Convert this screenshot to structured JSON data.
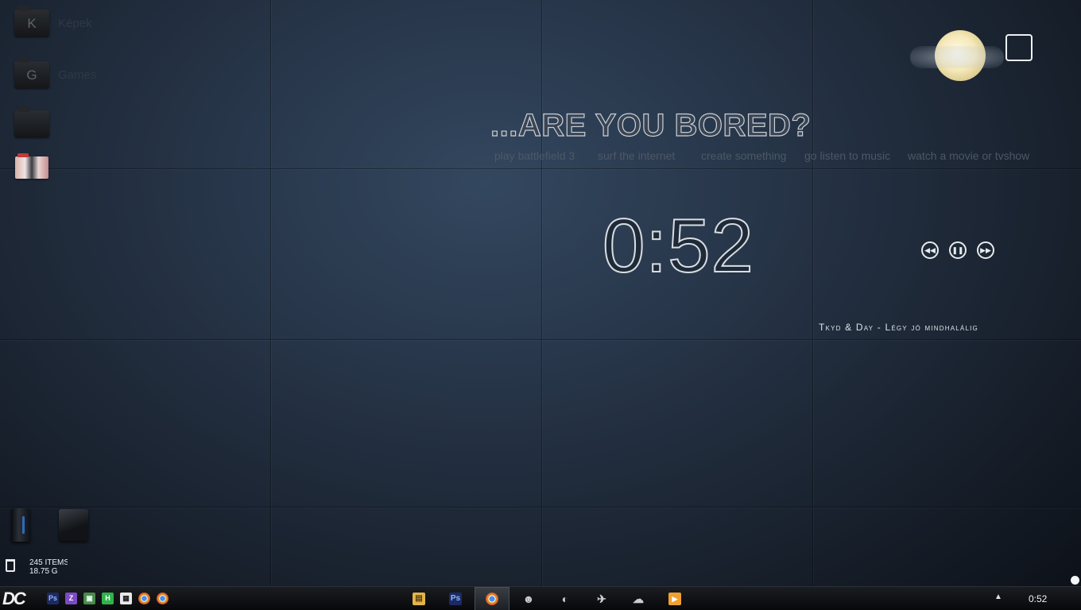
{
  "desktop": {
    "folders": [
      {
        "letter": "K",
        "label": "Képek"
      },
      {
        "letter": "G",
        "label": "Games"
      },
      {
        "letter": "",
        "label": ""
      }
    ]
  },
  "prompt": {
    "headline": "...ARE YOU BORED?",
    "activities": [
      "play battlefield 3",
      "surf the internet",
      "create something",
      "go listen to music",
      "watch a movie or tvshow"
    ]
  },
  "clock": {
    "time": "0:52"
  },
  "media": {
    "track": "Tkyd & Day - Légy jó mindhalálig",
    "prev_glyph": "◀◀",
    "pause_glyph": "❚❚",
    "next_glyph": "▶▶"
  },
  "recycle_bin": {
    "items": "245 ITEMS",
    "size": "18.75 G"
  },
  "taskbar": {
    "start_label": "DC",
    "quick_launch": [
      {
        "icon": "photoshop-icon",
        "glyph": "Ps",
        "color": "#1c2a63"
      },
      {
        "icon": "z-app-icon",
        "glyph": "Z",
        "color": "#7b4bc4"
      },
      {
        "icon": "image-viewer-icon",
        "glyph": "▣",
        "color": "#4a8a4a"
      },
      {
        "icon": "h-app-icon",
        "glyph": "H",
        "color": "#2fb34a"
      },
      {
        "icon": "calendar-icon",
        "glyph": "▦",
        "color": "#e8e8e8"
      },
      {
        "icon": "chrome-icon",
        "glyph": "●",
        "color": "#e0b020"
      },
      {
        "icon": "chrome-icon",
        "glyph": "●",
        "color": "#e0b020"
      }
    ],
    "apps": [
      {
        "icon": "explorer-icon",
        "glyph": "▤",
        "color": "#e3b44a"
      },
      {
        "icon": "photoshop-icon",
        "glyph": "Ps",
        "color": "#1c2a63"
      },
      {
        "icon": "chrome-icon",
        "glyph": "●",
        "color": "#e0b020"
      },
      {
        "icon": "agent-icon",
        "glyph": "☻",
        "color": "#c9ced4"
      },
      {
        "icon": "steam-icon",
        "glyph": "◐",
        "color": "#c9ced4"
      },
      {
        "icon": "plane-icon",
        "glyph": "✈",
        "color": "#c9ced4"
      },
      {
        "icon": "weather-icon",
        "glyph": "☁",
        "color": "#c9ced4"
      },
      {
        "icon": "media-player-icon",
        "glyph": "▶",
        "color": "#f0a030"
      }
    ],
    "tray_arrow": "▲",
    "clock": "0:52"
  }
}
